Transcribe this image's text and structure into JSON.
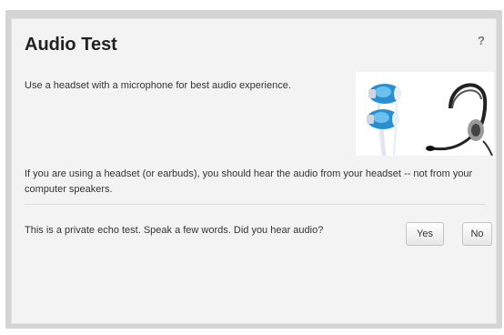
{
  "dialog": {
    "title": "Audio Test",
    "help_label": "?",
    "headset_tip": "Use a headset with a microphone for best audio experience.",
    "headset_note": "If you are using a headset (or earbuds), you should hear the audio from your headset -- not from your computer speakers.",
    "echo_prompt": "This is a private echo test.  Speak a few words.  Did you hear audio?",
    "yes_label": "Yes",
    "no_label": "No"
  },
  "images": {
    "headset_image": "earbuds-and-headset-icon"
  },
  "colors": {
    "earbud_blue": "#2a8fd0",
    "dialog_bg": "#f3f3f3",
    "frame_bg": "#d4d4d4"
  }
}
